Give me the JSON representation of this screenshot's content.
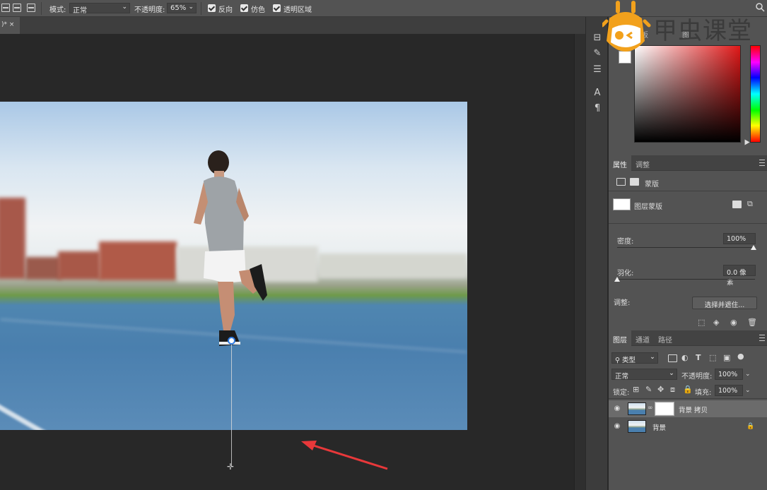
{
  "options_bar": {
    "mode_label": "模式:",
    "mode_value": "正常",
    "opacity_label": "不透明度:",
    "opacity_value": "65%",
    "reverse_label": "反向",
    "dither_label": "仿色",
    "transparency_label": "透明区域"
  },
  "document_tab": {
    "label": ")* ×"
  },
  "watermark": {
    "text": "甲虫课堂"
  },
  "color_panel": {
    "tabs": [
      "板",
      "图"
    ],
    "accent_hue": "#e01818"
  },
  "properties_panel": {
    "tabs": [
      "属性",
      "调整"
    ],
    "mask_label": "蒙版",
    "layer_mask_label": "图层蒙版",
    "density_label": "密度:",
    "density_value": "100%",
    "feather_label": "羽化:",
    "feather_value": "0.0 像素",
    "adjust_label": "调整:",
    "select_mask_button": "选择并遮住..."
  },
  "layers_panel": {
    "tabs": [
      "图层",
      "通道",
      "路径"
    ],
    "filter_kind": "类型",
    "blend_mode": "正常",
    "opacity_label": "不透明度:",
    "opacity_value": "100%",
    "lock_label": "锁定:",
    "fill_label": "填充:",
    "fill_value": "100%",
    "layers": [
      {
        "name": "背景 拷贝",
        "selected": true,
        "has_mask": true,
        "locked": false
      },
      {
        "name": "背景",
        "selected": false,
        "has_mask": false,
        "locked": true
      }
    ]
  },
  "annotation": {
    "arrow_color": "#e8383a"
  }
}
